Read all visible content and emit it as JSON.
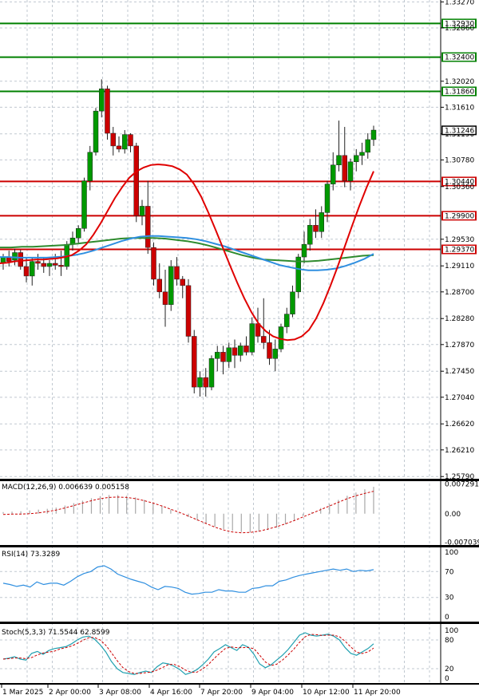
{
  "chart_data": {
    "type": "candlestick",
    "colors": {
      "up": "#009900",
      "down": "#cc0000",
      "grid": "#c0c8d0",
      "ma_red": "#e00000",
      "ma_blue": "#2f8fe0",
      "ma_green": "#2e8b2e"
    },
    "price_axis": {
      "labels": [
        "1.33270",
        "1.32860",
        "1.32020",
        "1.31610",
        "1.31190",
        "1.30780",
        "1.30360",
        "1.29530",
        "1.29110",
        "1.28700",
        "1.28280",
        "1.27870",
        "1.27450",
        "1.27040",
        "1.26620",
        "1.26210",
        "1.25790"
      ],
      "range": [
        1.25755,
        1.333
      ]
    },
    "time_axis": [
      "1 Mar 2025",
      "2 Apr 00:00",
      "3 Apr 08:00",
      "4 Apr 16:00",
      "7 Apr 20:00",
      "9 Apr 04:00",
      "10 Apr 12:00",
      "11 Apr 20:00"
    ],
    "levels": [
      {
        "value": "1.32930",
        "price": 1.3293,
        "color": "#008000"
      },
      {
        "value": "1.32400",
        "price": 1.324,
        "color": "#008000"
      },
      {
        "value": "1.31860",
        "price": 1.3186,
        "color": "#008000"
      },
      {
        "value": "1.30440",
        "price": 1.3044,
        "color": "#cc0000"
      },
      {
        "value": "1.29900",
        "price": 1.299,
        "color": "#cc0000"
      },
      {
        "value": "1.29370",
        "price": 1.2937,
        "color": "#cc0000"
      }
    ],
    "current_price": "1.31246",
    "candles": [
      {
        "o": 1.2916,
        "h": 1.293,
        "l": 1.2905,
        "c": 1.2925
      },
      {
        "o": 1.2925,
        "h": 1.2935,
        "l": 1.291,
        "c": 1.2918
      },
      {
        "o": 1.292,
        "h": 1.2938,
        "l": 1.2912,
        "c": 1.2932
      },
      {
        "o": 1.2932,
        "h": 1.2936,
        "l": 1.2905,
        "c": 1.291
      },
      {
        "o": 1.291,
        "h": 1.2925,
        "l": 1.2885,
        "c": 1.2895
      },
      {
        "o": 1.2895,
        "h": 1.2925,
        "l": 1.288,
        "c": 1.2918
      },
      {
        "o": 1.2918,
        "h": 1.293,
        "l": 1.2905,
        "c": 1.2915
      },
      {
        "o": 1.2915,
        "h": 1.2925,
        "l": 1.29,
        "c": 1.291
      },
      {
        "o": 1.291,
        "h": 1.292,
        "l": 1.2895,
        "c": 1.2915
      },
      {
        "o": 1.2915,
        "h": 1.293,
        "l": 1.2905,
        "c": 1.2912
      },
      {
        "o": 1.2912,
        "h": 1.2935,
        "l": 1.2895,
        "c": 1.291
      },
      {
        "o": 1.291,
        "h": 1.295,
        "l": 1.2905,
        "c": 1.2945
      },
      {
        "o": 1.2945,
        "h": 1.2965,
        "l": 1.2935,
        "c": 1.2955
      },
      {
        "o": 1.2955,
        "h": 1.2975,
        "l": 1.2945,
        "c": 1.297
      },
      {
        "o": 1.297,
        "h": 1.305,
        "l": 1.2965,
        "c": 1.3045
      },
      {
        "o": 1.3045,
        "h": 1.31,
        "l": 1.303,
        "c": 1.309
      },
      {
        "o": 1.309,
        "h": 1.316,
        "l": 1.3085,
        "c": 1.3155
      },
      {
        "o": 1.3155,
        "h": 1.3205,
        "l": 1.3145,
        "c": 1.319
      },
      {
        "o": 1.319,
        "h": 1.3195,
        "l": 1.311,
        "c": 1.312
      },
      {
        "o": 1.312,
        "h": 1.313,
        "l": 1.3085,
        "c": 1.31
      },
      {
        "o": 1.31,
        "h": 1.3115,
        "l": 1.309,
        "c": 1.3095
      },
      {
        "o": 1.3095,
        "h": 1.3125,
        "l": 1.3088,
        "c": 1.3118
      },
      {
        "o": 1.3118,
        "h": 1.312,
        "l": 1.309,
        "c": 1.31
      },
      {
        "o": 1.31,
        "h": 1.3105,
        "l": 1.298,
        "c": 1.299
      },
      {
        "o": 1.299,
        "h": 1.3015,
        "l": 1.2975,
        "c": 1.3005
      },
      {
        "o": 1.3005,
        "h": 1.3045,
        "l": 1.293,
        "c": 1.294
      },
      {
        "o": 1.294,
        "h": 1.2948,
        "l": 1.288,
        "c": 1.289
      },
      {
        "o": 1.289,
        "h": 1.2915,
        "l": 1.286,
        "c": 1.287
      },
      {
        "o": 1.287,
        "h": 1.2905,
        "l": 1.2815,
        "c": 1.285
      },
      {
        "o": 1.285,
        "h": 1.292,
        "l": 1.284,
        "c": 1.291
      },
      {
        "o": 1.291,
        "h": 1.2925,
        "l": 1.288,
        "c": 1.289
      },
      {
        "o": 1.289,
        "h": 1.2895,
        "l": 1.286,
        "c": 1.288
      },
      {
        "o": 1.288,
        "h": 1.289,
        "l": 1.279,
        "c": 1.28
      },
      {
        "o": 1.28,
        "h": 1.281,
        "l": 1.271,
        "c": 1.272
      },
      {
        "o": 1.272,
        "h": 1.2745,
        "l": 1.2705,
        "c": 1.2735
      },
      {
        "o": 1.2735,
        "h": 1.275,
        "l": 1.2705,
        "c": 1.272
      },
      {
        "o": 1.272,
        "h": 1.277,
        "l": 1.2715,
        "c": 1.2765
      },
      {
        "o": 1.2765,
        "h": 1.2785,
        "l": 1.2745,
        "c": 1.2775
      },
      {
        "o": 1.2775,
        "h": 1.2785,
        "l": 1.274,
        "c": 1.276
      },
      {
        "o": 1.276,
        "h": 1.279,
        "l": 1.275,
        "c": 1.2782
      },
      {
        "o": 1.2782,
        "h": 1.2795,
        "l": 1.275,
        "c": 1.277
      },
      {
        "o": 1.277,
        "h": 1.279,
        "l": 1.276,
        "c": 1.2785
      },
      {
        "o": 1.2785,
        "h": 1.28,
        "l": 1.277,
        "c": 1.2775
      },
      {
        "o": 1.2775,
        "h": 1.283,
        "l": 1.277,
        "c": 1.282
      },
      {
        "o": 1.282,
        "h": 1.2845,
        "l": 1.279,
        "c": 1.28
      },
      {
        "o": 1.28,
        "h": 1.286,
        "l": 1.278,
        "c": 1.279
      },
      {
        "o": 1.279,
        "h": 1.281,
        "l": 1.2755,
        "c": 1.2765
      },
      {
        "o": 1.2765,
        "h": 1.2795,
        "l": 1.2745,
        "c": 1.278
      },
      {
        "o": 1.278,
        "h": 1.282,
        "l": 1.2775,
        "c": 1.2815
      },
      {
        "o": 1.2815,
        "h": 1.2845,
        "l": 1.2805,
        "c": 1.2835
      },
      {
        "o": 1.2835,
        "h": 1.288,
        "l": 1.283,
        "c": 1.287
      },
      {
        "o": 1.287,
        "h": 1.293,
        "l": 1.286,
        "c": 1.2925
      },
      {
        "o": 1.2925,
        "h": 1.2965,
        "l": 1.2915,
        "c": 1.2945
      },
      {
        "o": 1.2945,
        "h": 1.2985,
        "l": 1.2935,
        "c": 1.2975
      },
      {
        "o": 1.2975,
        "h": 1.3,
        "l": 1.2955,
        "c": 1.2965
      },
      {
        "o": 1.2965,
        "h": 1.3005,
        "l": 1.2955,
        "c": 1.2995
      },
      {
        "o": 1.2995,
        "h": 1.3045,
        "l": 1.298,
        "c": 1.304
      },
      {
        "o": 1.304,
        "h": 1.309,
        "l": 1.303,
        "c": 1.307
      },
      {
        "o": 1.307,
        "h": 1.314,
        "l": 1.306,
        "c": 1.3085
      },
      {
        "o": 1.3085,
        "h": 1.313,
        "l": 1.3035,
        "c": 1.3045
      },
      {
        "o": 1.3045,
        "h": 1.308,
        "l": 1.303,
        "c": 1.3075
      },
      {
        "o": 1.3075,
        "h": 1.3095,
        "l": 1.306,
        "c": 1.3085
      },
      {
        "o": 1.3085,
        "h": 1.3105,
        "l": 1.307,
        "c": 1.309
      },
      {
        "o": 1.309,
        "h": 1.312,
        "l": 1.308,
        "c": 1.311
      },
      {
        "o": 1.311,
        "h": 1.3132,
        "l": 1.31,
        "c": 1.3125
      }
    ],
    "ma_red": [
      1.2915,
      1.2916,
      1.2918,
      1.2919,
      1.292,
      1.2921,
      1.2921,
      1.2922,
      1.2923,
      1.2925,
      1.2928,
      1.2935,
      1.2945,
      1.296,
      1.2978,
      1.2998,
      1.3018,
      1.3035,
      1.305,
      1.306,
      1.3066,
      1.307,
      1.3071,
      1.307,
      1.3068,
      1.3063,
      1.3055,
      1.304,
      1.302,
      1.2995,
      1.2968,
      1.294,
      1.2912,
      1.2885,
      1.286,
      1.2838,
      1.282,
      1.2808,
      1.28,
      1.2796,
      1.2794,
      1.2795,
      1.28,
      1.281,
      1.2828,
      1.2852,
      1.288,
      1.291,
      1.2942,
      1.2974,
      1.3005,
      1.3034,
      1.306
    ],
    "ma_blue": [
      1.2925,
      1.2925,
      1.2924,
      1.2924,
      1.2924,
      1.2924,
      1.2925,
      1.2926,
      1.2928,
      1.2931,
      1.2935,
      1.294,
      1.2945,
      1.295,
      1.2954,
      1.2957,
      1.2958,
      1.2958,
      1.2957,
      1.2956,
      1.2955,
      1.2953,
      1.295,
      1.2946,
      1.2942,
      1.2937,
      1.2932,
      1.2927,
      1.2922,
      1.2917,
      1.2912,
      1.2909,
      1.2906,
      1.2904,
      1.2904,
      1.2905,
      1.2907,
      1.2911,
      1.2916,
      1.2922,
      1.293
    ],
    "ma_green": [
      1.294,
      1.294,
      1.2941,
      1.2941,
      1.2942,
      1.2943,
      1.2944,
      1.2946,
      1.2948,
      1.295,
      1.2952,
      1.2954,
      1.2955,
      1.2955,
      1.2955,
      1.2954,
      1.2952,
      1.295,
      1.2947,
      1.2943,
      1.2938,
      1.2933,
      1.2928,
      1.2924,
      1.2921,
      1.292,
      1.2919,
      1.2918,
      1.2918,
      1.2919,
      1.2921,
      1.2923,
      1.2925,
      1.2927,
      1.2928
    ],
    "macd": {
      "title": "MACD(12,26,9) 0.006639 0.005158",
      "axis": [
        "0.007291",
        "0.00",
        "-0.007039"
      ],
      "range": [
        -0.0075,
        0.0078
      ],
      "hist": [
        0.0004,
        0.0005,
        0.0006,
        0.0008,
        0.001,
        0.0012,
        0.0015,
        0.002,
        0.0026,
        0.0032,
        0.0038,
        0.0043,
        0.0046,
        0.0046,
        0.0044,
        0.004,
        0.0034,
        0.0028,
        0.002,
        0.001,
        0.0001,
        -0.0008,
        -0.0017,
        -0.0025,
        -0.0032,
        -0.0038,
        -0.0042,
        -0.0045,
        -0.0046,
        -0.0044,
        -0.004,
        -0.0034,
        -0.0026,
        -0.0016,
        -0.0006,
        0.0004,
        0.0014,
        0.0024,
        0.0034,
        0.0044,
        0.0052,
        0.006,
        0.0066
      ],
      "signal": [
        -0.0002,
        -0.0001,
        -0.0001,
        0.0,
        0.0002,
        0.0005,
        0.0009,
        0.0014,
        0.002,
        0.0026,
        0.0032,
        0.0037,
        0.004,
        0.0041,
        0.004,
        0.0037,
        0.0032,
        0.0026,
        0.0019,
        0.0011,
        0.0003,
        -0.0006,
        -0.0015,
        -0.0024,
        -0.0033,
        -0.004,
        -0.0045,
        -0.0047,
        -0.0046,
        -0.0043,
        -0.0038,
        -0.0032,
        -0.0025,
        -0.0017,
        -0.0008,
        0.0001,
        0.001,
        0.0019,
        0.0028,
        0.0037,
        0.0044,
        0.005,
        0.0055
      ]
    },
    "rsi": {
      "title": "RSI(14) 73.3289",
      "axis": [
        "100",
        "70",
        "30",
        "0"
      ],
      "values": [
        52,
        50,
        47,
        49,
        46,
        54,
        50,
        52,
        52,
        49,
        55,
        62,
        67,
        70,
        77,
        79,
        74,
        66,
        62,
        58,
        55,
        52,
        46,
        42,
        47,
        46,
        44,
        38,
        35,
        36,
        38,
        38,
        42,
        40,
        40,
        38,
        38,
        44,
        45,
        48,
        48,
        55,
        57,
        61,
        64,
        66,
        68,
        70,
        72,
        74,
        72,
        74,
        70,
        72,
        71,
        73
      ]
    },
    "stoch": {
      "title": "Stoch(5,3,3) 71.5544 62.8599",
      "axis": [
        "100",
        "80",
        "20",
        "0"
      ],
      "k": [
        40,
        42,
        45,
        40,
        38,
        52,
        56,
        50,
        58,
        62,
        64,
        66,
        72,
        80,
        86,
        88,
        82,
        70,
        55,
        35,
        20,
        12,
        10,
        8,
        12,
        15,
        12,
        24,
        32,
        30,
        25,
        18,
        8,
        12,
        18,
        28,
        40,
        55,
        62,
        70,
        64,
        58,
        70,
        65,
        50,
        30,
        22,
        28,
        38,
        48,
        60,
        75,
        90,
        95,
        90,
        88,
        90,
        92,
        88,
        80,
        64,
        52,
        48,
        55,
        62,
        72
      ]
    }
  }
}
